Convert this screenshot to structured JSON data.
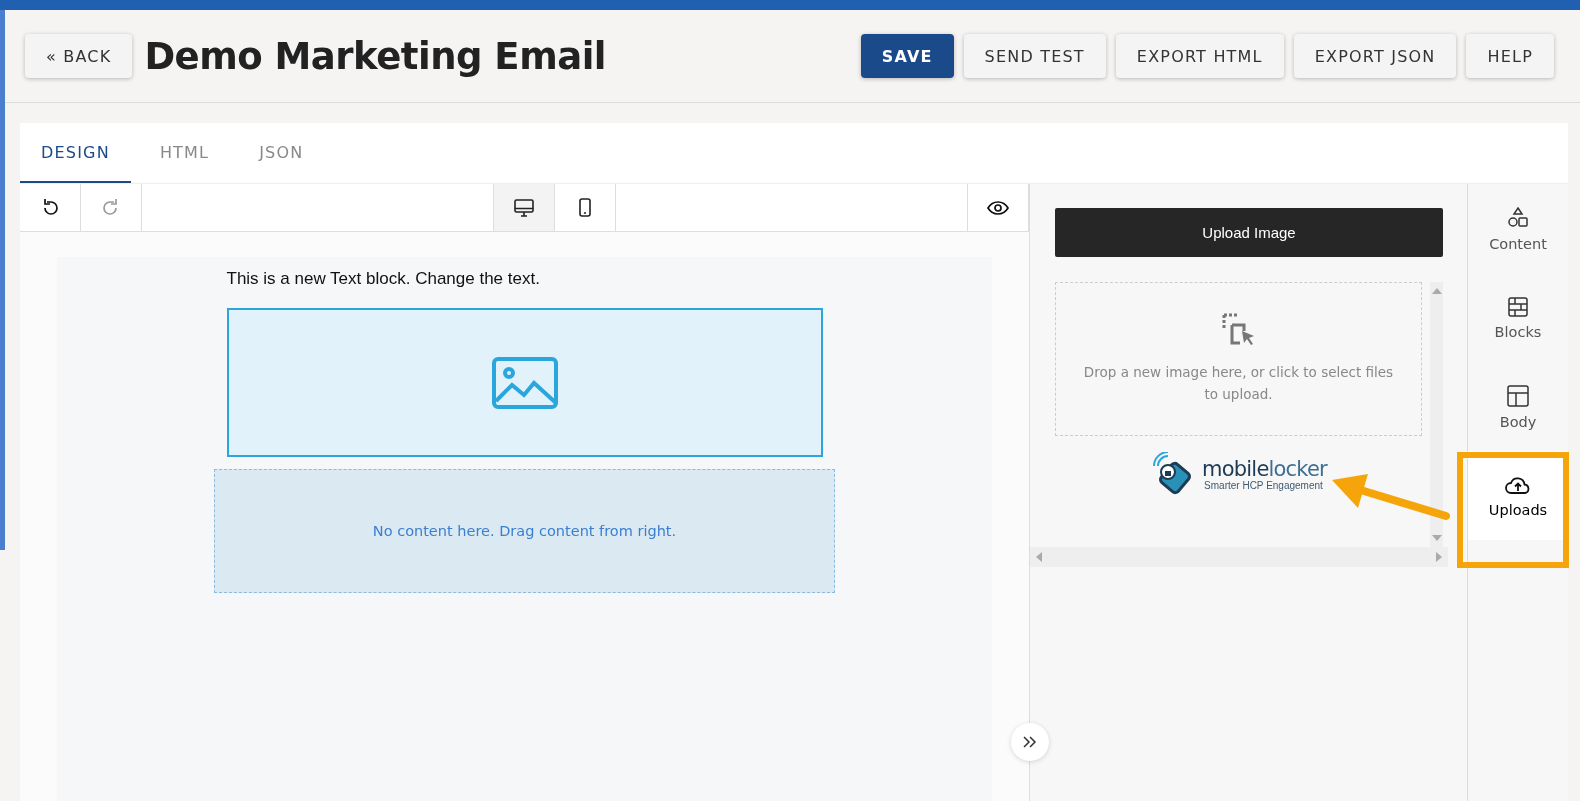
{
  "header": {
    "back_label": "« BACK",
    "title": "Demo Marketing Email",
    "actions": [
      {
        "label": "SAVE",
        "kind": "primary"
      },
      {
        "label": "SEND TEST",
        "kind": "default"
      },
      {
        "label": "EXPORT HTML",
        "kind": "default"
      },
      {
        "label": "EXPORT JSON",
        "kind": "default"
      },
      {
        "label": "HELP",
        "kind": "default"
      }
    ]
  },
  "tabs": [
    {
      "label": "DESIGN",
      "selected": true
    },
    {
      "label": "HTML",
      "selected": false
    },
    {
      "label": "JSON",
      "selected": false
    }
  ],
  "toolbar": {
    "redo_disabled": true,
    "devices": [
      {
        "kind": "desktop",
        "selected": true
      },
      {
        "kind": "mobile",
        "selected": false
      }
    ]
  },
  "canvas": {
    "text_block": "This is a new Text block. Change the text.",
    "empty_hint": "No content here. Drag content from right."
  },
  "uploads_panel": {
    "upload_button": "Upload Image",
    "drop_hint": "Drop a new image here, or click to select files to upload.",
    "logo": {
      "word_dark": "mobile",
      "word_light": "locker",
      "tagline": "Smarter HCP Engagement"
    }
  },
  "side_tabs": [
    {
      "label": "Content",
      "kind": "shapes",
      "selected": false
    },
    {
      "label": "Blocks",
      "kind": "blocks",
      "selected": false
    },
    {
      "label": "Body",
      "kind": "body",
      "selected": false
    },
    {
      "label": "Uploads",
      "kind": "uploads",
      "selected": true
    }
  ]
}
